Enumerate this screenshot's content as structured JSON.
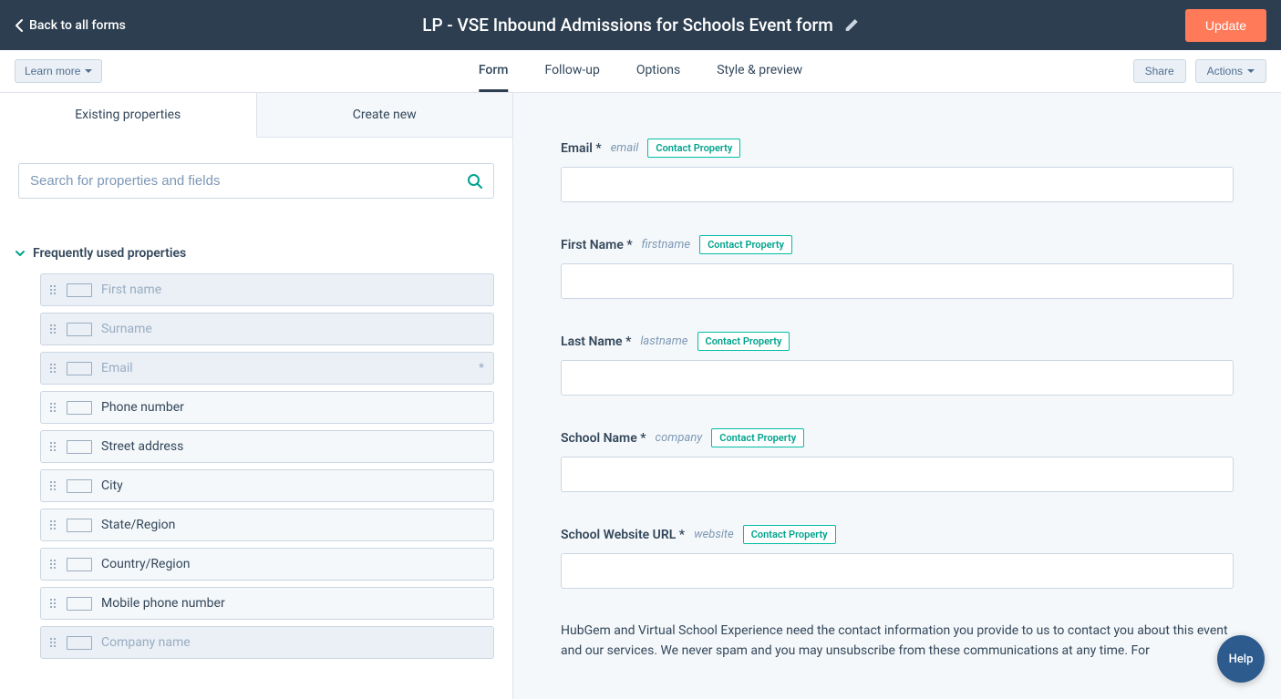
{
  "header": {
    "back_label": "Back to all forms",
    "title": "LP - VSE Inbound Admissions for Schools Event form",
    "update_label": "Update"
  },
  "subbar": {
    "learn_more": "Learn more",
    "tabs": [
      {
        "label": "Form",
        "active": true
      },
      {
        "label": "Follow-up",
        "active": false
      },
      {
        "label": "Options",
        "active": false
      },
      {
        "label": "Style & preview",
        "active": false
      }
    ],
    "share_label": "Share",
    "actions_label": "Actions"
  },
  "left": {
    "tabs": [
      {
        "label": "Existing properties",
        "active": true
      },
      {
        "label": "Create new",
        "active": false
      }
    ],
    "search_placeholder": "Search for properties and fields",
    "section_title": "Frequently used properties",
    "properties": [
      {
        "label": "First name",
        "disabled": true,
        "required": false
      },
      {
        "label": "Surname",
        "disabled": true,
        "required": false
      },
      {
        "label": "Email",
        "disabled": true,
        "required": true
      },
      {
        "label": "Phone number",
        "disabled": false,
        "required": false
      },
      {
        "label": "Street address",
        "disabled": false,
        "required": false
      },
      {
        "label": "City",
        "disabled": false,
        "required": false
      },
      {
        "label": "State/Region",
        "disabled": false,
        "required": false
      },
      {
        "label": "Country/Region",
        "disabled": false,
        "required": false
      },
      {
        "label": "Mobile phone number",
        "disabled": false,
        "required": false
      },
      {
        "label": "Company name",
        "disabled": true,
        "required": false
      }
    ]
  },
  "form": {
    "badge_label": "Contact Property",
    "fields": [
      {
        "label": "Email *",
        "internal": "email"
      },
      {
        "label": "First Name *",
        "internal": "firstname"
      },
      {
        "label": "Last Name *",
        "internal": "lastname"
      },
      {
        "label": "School Name *",
        "internal": "company"
      },
      {
        "label": "School Website URL *",
        "internal": "website"
      }
    ],
    "consent_text": "HubGem and Virtual School Experience need the contact information you provide to us to contact you about this event and our services. We never spam and you may unsubscribe from these communications at any time. For"
  },
  "help_label": "Help"
}
